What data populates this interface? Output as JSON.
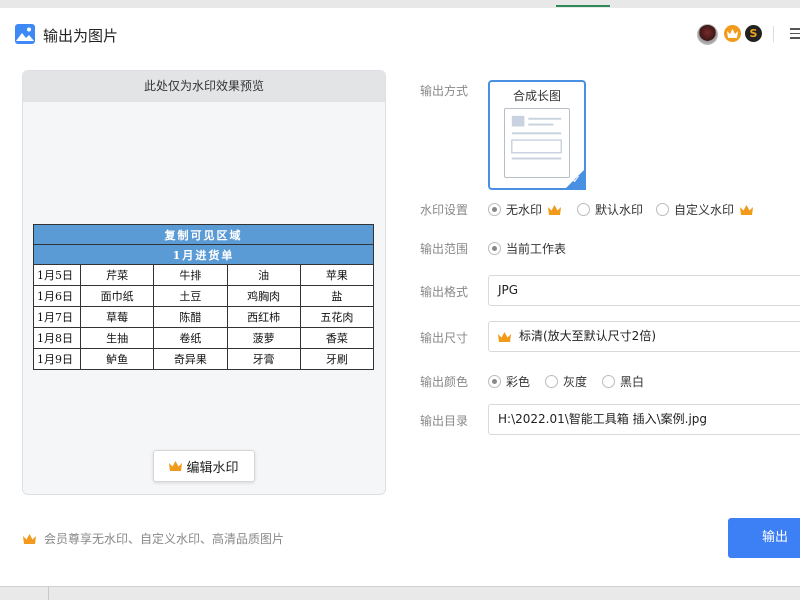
{
  "dialog": {
    "title": "输出为图片"
  },
  "preview": {
    "header": "此处仅为水印效果预览",
    "sheet": {
      "banner": "复制可见区域",
      "title": "1月进货单",
      "rows": [
        [
          "1月5日",
          "芹菜",
          "牛排",
          "油",
          "苹果"
        ],
        [
          "1月6日",
          "面巾纸",
          "土豆",
          "鸡胸肉",
          "盐"
        ],
        [
          "1月7日",
          "草莓",
          "陈醋",
          "西红柿",
          "五花肉"
        ],
        [
          "1月8日",
          "生抽",
          "卷纸",
          "菠萝",
          "香菜"
        ],
        [
          "1月9日",
          "鲈鱼",
          "奇异果",
          "牙膏",
          "牙刷"
        ]
      ]
    },
    "edit_watermark_label": "编辑水印"
  },
  "form": {
    "output_mode": {
      "label": "输出方式",
      "option": "合成长图"
    },
    "watermark": {
      "label": "水印设置",
      "options": [
        "无水印",
        "默认水印",
        "自定义水印"
      ],
      "selected": "无水印"
    },
    "range": {
      "label": "输出范围",
      "option": "当前工作表"
    },
    "format": {
      "label": "输出格式",
      "value": "JPG"
    },
    "size": {
      "label": "输出尺寸",
      "value": "标清(放大至默认尺寸2倍)"
    },
    "color": {
      "label": "输出颜色",
      "options": [
        "彩色",
        "灰度",
        "黑白"
      ],
      "selected": "彩色"
    },
    "directory": {
      "label": "输出目录",
      "value": "H:\\2022.01\\智能工具箱 插入\\案例.jpg"
    }
  },
  "footer": {
    "note": "会员尊享无水印、自定义水印、高清品质图片",
    "export_label": "输出"
  },
  "colors": {
    "accent": "#3d7ff5",
    "crown": "#f29a1c",
    "sheet_header": "#5b9bd5"
  }
}
